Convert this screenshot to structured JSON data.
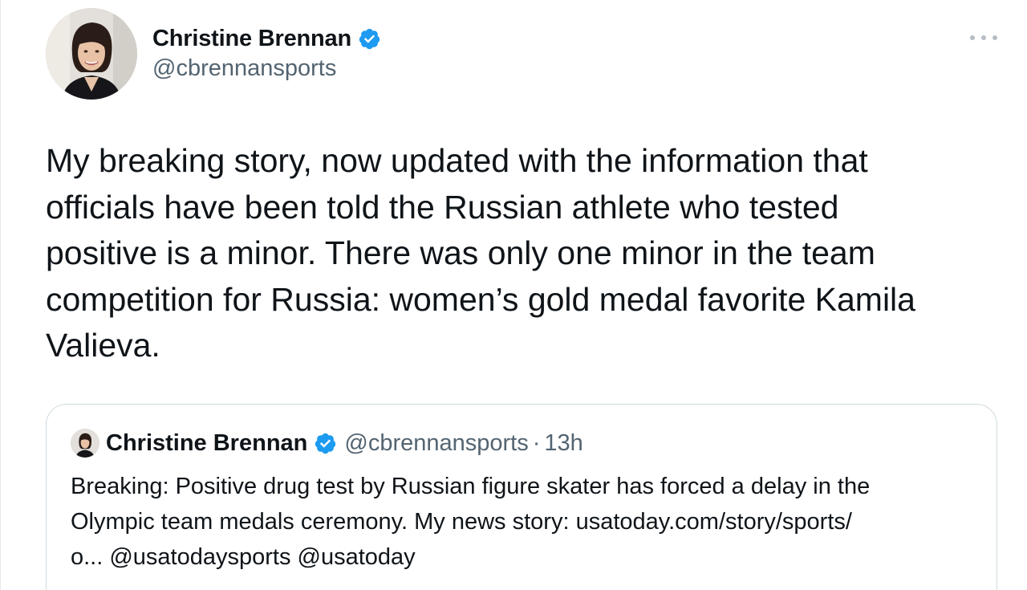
{
  "tweet": {
    "author_name": "Christine Brennan",
    "author_handle": "@cbrennansports",
    "body": "My breaking story, now updated with the information that\nofficials have been told the Russian athlete who tested\npositive is a minor. There was only one minor in the team\ncompetition for Russia: women’s gold medal favorite Kamila\nValieva.",
    "verified_color": "#1d9bf0",
    "more_icon": "more-horizontal-icon"
  },
  "quoted_tweet": {
    "author_name": "Christine Brennan",
    "author_handle": "@cbrennansports",
    "separator": "·",
    "time": "13h",
    "body": "Breaking: Positive drug test by Russian figure skater has forced a delay in the\nOlympic team medals ceremony. My news story: usatoday.com/story/sports/\no... @usatodaysports @usatoday"
  }
}
